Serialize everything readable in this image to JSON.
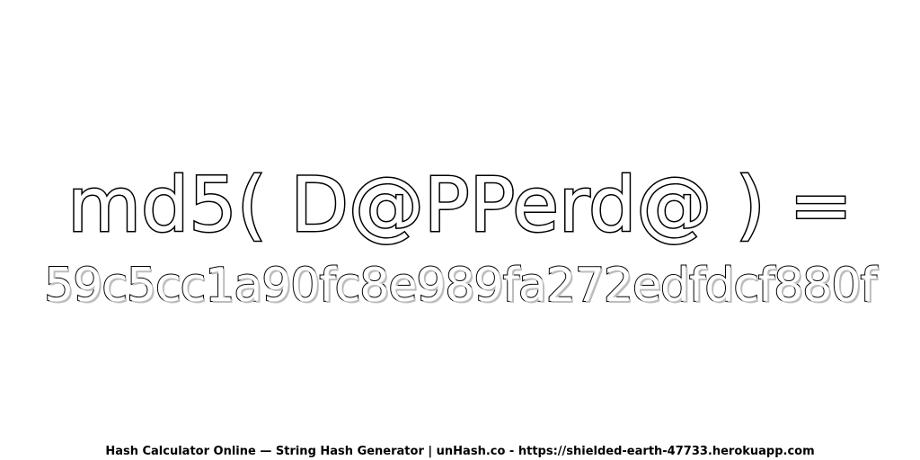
{
  "expression": "md5( D@PPerd@ ) =",
  "hash": "59c5cc1a90fc8e989fa272edfdcf880f",
  "footer": "Hash Calculator Online — String Hash Generator | unHash.co - https://shielded-earth-47733.herokuapp.com",
  "colors": {
    "background": "#ffffff",
    "text_fill": "#ffffff",
    "text_outline": "#000000",
    "shadow": "#bdbdbd"
  }
}
